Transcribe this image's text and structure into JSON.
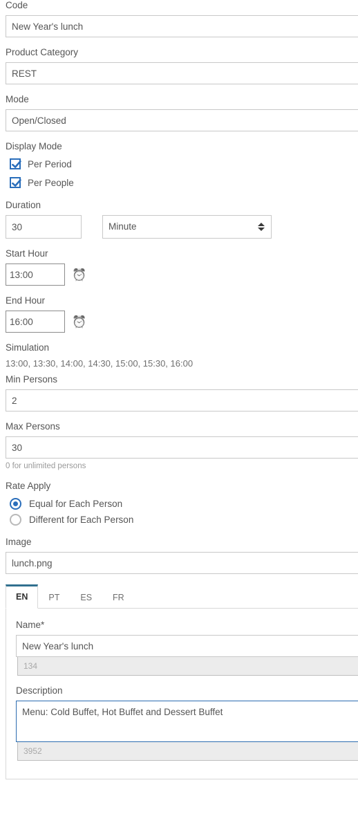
{
  "form": {
    "code": {
      "label": "Code",
      "value": "New Year's lunch"
    },
    "product_category": {
      "label": "Product Category",
      "value": "REST"
    },
    "mode": {
      "label": "Mode",
      "value": "Open/Closed"
    },
    "display_mode": {
      "label": "Display Mode",
      "options": [
        {
          "label": "Per Period",
          "checked": true
        },
        {
          "label": "Per People",
          "checked": true
        }
      ]
    },
    "duration": {
      "label": "Duration",
      "amount": "30",
      "unit": "Minute"
    },
    "start_hour": {
      "label": "Start Hour",
      "value": "13:00",
      "icon": "alarm-clock-icon"
    },
    "end_hour": {
      "label": "End Hour",
      "value": "16:00",
      "icon": "alarm-clock-icon"
    },
    "simulation": {
      "label": "Simulation",
      "values": "13:00, 13:30, 14:00, 14:30, 15:00, 15:30, 16:00"
    },
    "min_persons": {
      "label": "Min Persons",
      "value": "2"
    },
    "max_persons": {
      "label": "Max Persons",
      "value": "30",
      "hint": "0 for unlimited persons"
    },
    "rate_apply": {
      "label": "Rate Apply",
      "options": [
        {
          "label": "Equal for Each Person",
          "selected": true
        },
        {
          "label": "Different for Each Person",
          "selected": false
        }
      ]
    },
    "image": {
      "label": "Image",
      "value": "lunch.png"
    }
  },
  "language_tabs": {
    "tabs": [
      {
        "label": "EN",
        "active": true
      },
      {
        "label": "PT",
        "active": false
      },
      {
        "label": "ES",
        "active": false
      },
      {
        "label": "FR",
        "active": false
      }
    ],
    "name": {
      "label": "Name*",
      "value": "New Year's lunch",
      "counter": "134"
    },
    "description": {
      "label": "Description",
      "value": "Menu: Cold Buffet, Hot Buffet and Dessert Buffet",
      "counter": "3952"
    }
  },
  "colors": {
    "accent_blue": "#2a6ebb",
    "tab_active_border": "#31708f",
    "focus_border": "#2b6cb0",
    "label_text": "#555555",
    "hint_text": "#9a9a9a",
    "input_border": "#c8c8c8",
    "counter_bg": "#ececec"
  }
}
